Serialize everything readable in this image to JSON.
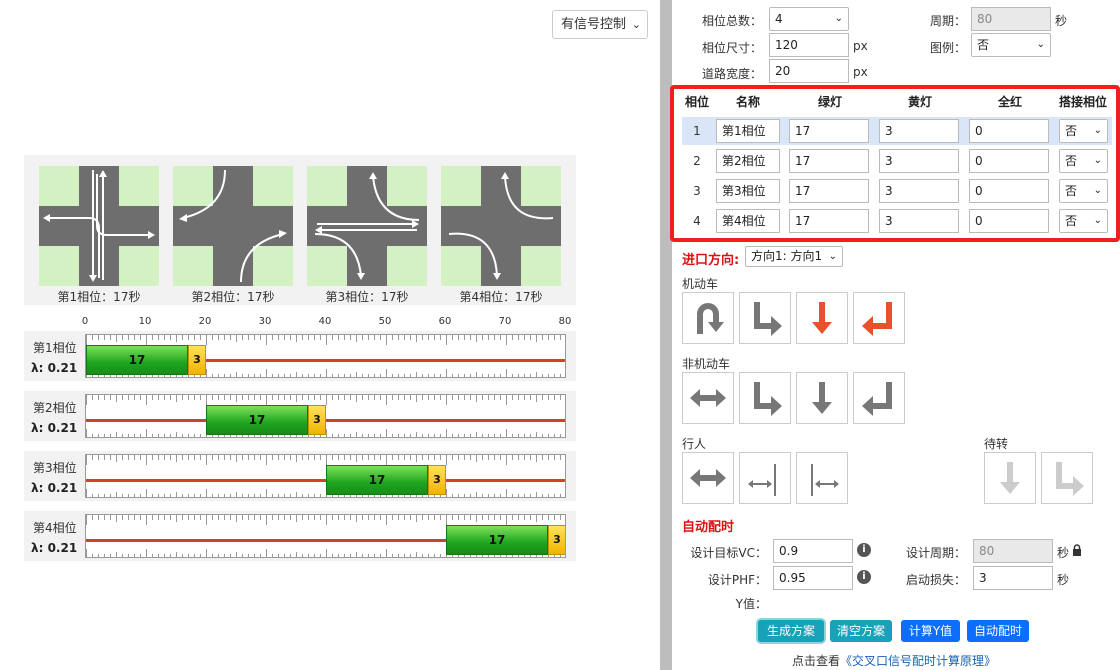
{
  "left": {
    "mode_select": "有信号控制",
    "phase_labels": [
      "第1相位：17秒",
      "第2相位：17秒",
      "第3相位：17秒",
      "第4相位：17秒"
    ],
    "axis_ticks": [
      "0",
      "10",
      "20",
      "30",
      "40",
      "50",
      "60",
      "70",
      "80"
    ],
    "timeline": [
      {
        "name": "第1相位",
        "lambda": "λ: 0.21",
        "green": "17",
        "yellow": "3",
        "start": 0,
        "green_dur": 17,
        "yellow_dur": 3
      },
      {
        "name": "第2相位",
        "lambda": "λ: 0.21",
        "green": "17",
        "yellow": "3",
        "start": 20,
        "green_dur": 17,
        "yellow_dur": 3
      },
      {
        "name": "第3相位",
        "lambda": "λ: 0.21",
        "green": "17",
        "yellow": "3",
        "start": 40,
        "green_dur": 17,
        "yellow_dur": 3
      },
      {
        "name": "第4相位",
        "lambda": "λ: 0.21",
        "green": "17",
        "yellow": "3",
        "start": 60,
        "green_dur": 17,
        "yellow_dur": 3
      }
    ],
    "cycle_max": 80
  },
  "settings": {
    "phase_count_label": "相位总数：",
    "phase_count": "4",
    "cycle_label": "周期：",
    "cycle_value": "80",
    "cycle_unit": "秒",
    "phase_size_label": "相位尺寸：",
    "phase_size": "120",
    "px": "px",
    "legend_label": "图例：",
    "legend_value": "否",
    "road_width_label": "道路宽度：",
    "road_width": "20"
  },
  "table": {
    "headers": [
      "相位",
      "名称",
      "绿灯",
      "黄灯",
      "全红",
      "搭接相位"
    ],
    "rows": [
      {
        "num": "1",
        "name": "第1相位",
        "green": "17",
        "yellow": "3",
        "allred": "0",
        "overlap": "否"
      },
      {
        "num": "2",
        "name": "第2相位",
        "green": "17",
        "yellow": "3",
        "allred": "0",
        "overlap": "否"
      },
      {
        "num": "3",
        "name": "第3相位",
        "green": "17",
        "yellow": "3",
        "allred": "0",
        "overlap": "否"
      },
      {
        "num": "4",
        "name": "第4相位",
        "green": "17",
        "yellow": "3",
        "allred": "0",
        "overlap": "否"
      }
    ]
  },
  "direction": {
    "label": "进口方向:",
    "value": "方向1: 方向1",
    "motor_label": "机动车",
    "nonmotor_label": "非机动车",
    "ped_label": "行人",
    "wait_label": "待转"
  },
  "auto": {
    "title": "自动配时",
    "vc_label": "设计目标VC：",
    "vc_value": "0.9",
    "design_cycle_label": "设计周期：",
    "design_cycle_value": "80",
    "design_cycle_unit": "秒",
    "phf_label": "设计PHF：",
    "phf_value": "0.95",
    "startup_loss_label": "启动损失：",
    "startup_loss_value": "3",
    "startup_loss_unit": "秒",
    "y_label": "Y值："
  },
  "buttons": {
    "generate": "生成方案",
    "clear": "清空方案",
    "calc_y": "计算Y值",
    "auto_timing": "自动配时"
  },
  "footer": {
    "prefix": "点击查看",
    "link": "《交叉口信号配时计算原理》"
  },
  "colors": {
    "accent_red": "#f21d1d",
    "green_bar": "#1fa51f",
    "yellow_bar": "#f0b400",
    "btn_teal": "#17a2b8",
    "btn_blue": "#0d6efd",
    "arrow_orange": "#e8512a"
  }
}
